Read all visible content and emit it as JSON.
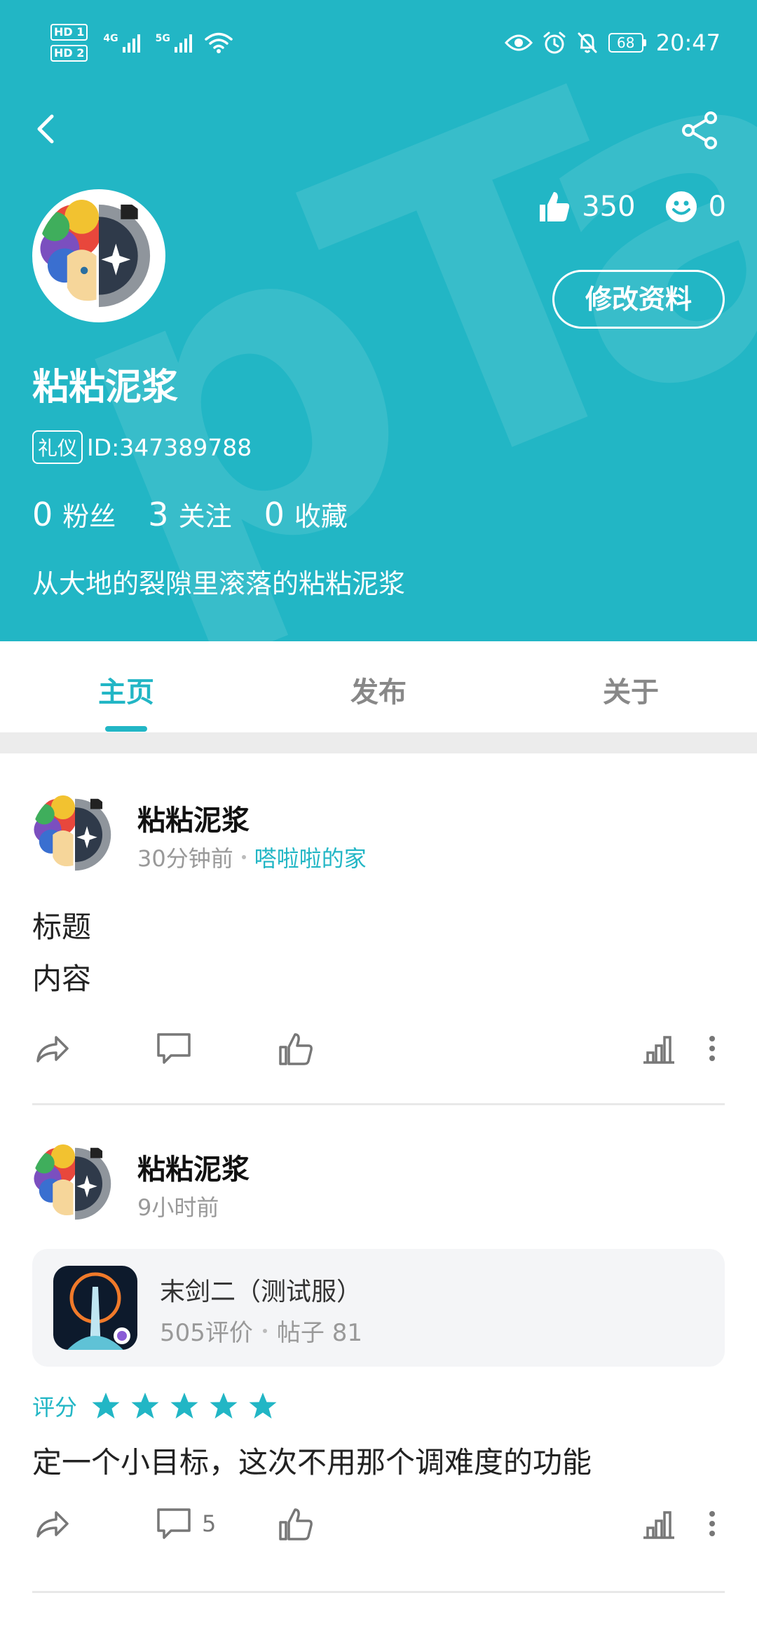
{
  "colors": {
    "accent": "#22b6c5",
    "header_bg": "#22b6c5"
  },
  "status_bar": {
    "hd1": "HD 1",
    "hd2": "HD 2",
    "net1": "4G",
    "net2": "5G",
    "battery": "68",
    "time": "20:47",
    "icons": [
      "eye-icon",
      "alarm-icon",
      "bell-off-icon"
    ]
  },
  "header": {
    "likes": "350",
    "smiles": "0",
    "edit_label": "修改资料",
    "username": "粘粘泥浆",
    "badge": "礼仪",
    "user_id": "ID:347389788",
    "follow": [
      {
        "count": "0",
        "label": "粉丝"
      },
      {
        "count": "3",
        "label": "关注"
      },
      {
        "count": "0",
        "label": "收藏"
      }
    ],
    "bio": "从大地的裂隙里滚落的粘粘泥浆"
  },
  "tabs": [
    {
      "label": "主页",
      "active": true
    },
    {
      "label": "发布",
      "active": false
    },
    {
      "label": "关于",
      "active": false
    }
  ],
  "posts": [
    {
      "author": "粘粘泥浆",
      "time": "30分钟前",
      "group": "嗒啦啦的家",
      "lines": [
        "标题",
        "内容"
      ]
    },
    {
      "author": "粘粘泥浆",
      "time": "9小时前",
      "game": {
        "name": "末剑二（测试服）",
        "reviews": "505评价",
        "posts": "帖子 81"
      },
      "rating_label": "评分",
      "rating_stars": 5,
      "text": "定一个小目标，这次不用那个调难度的功能",
      "comment_count": "5"
    }
  ]
}
